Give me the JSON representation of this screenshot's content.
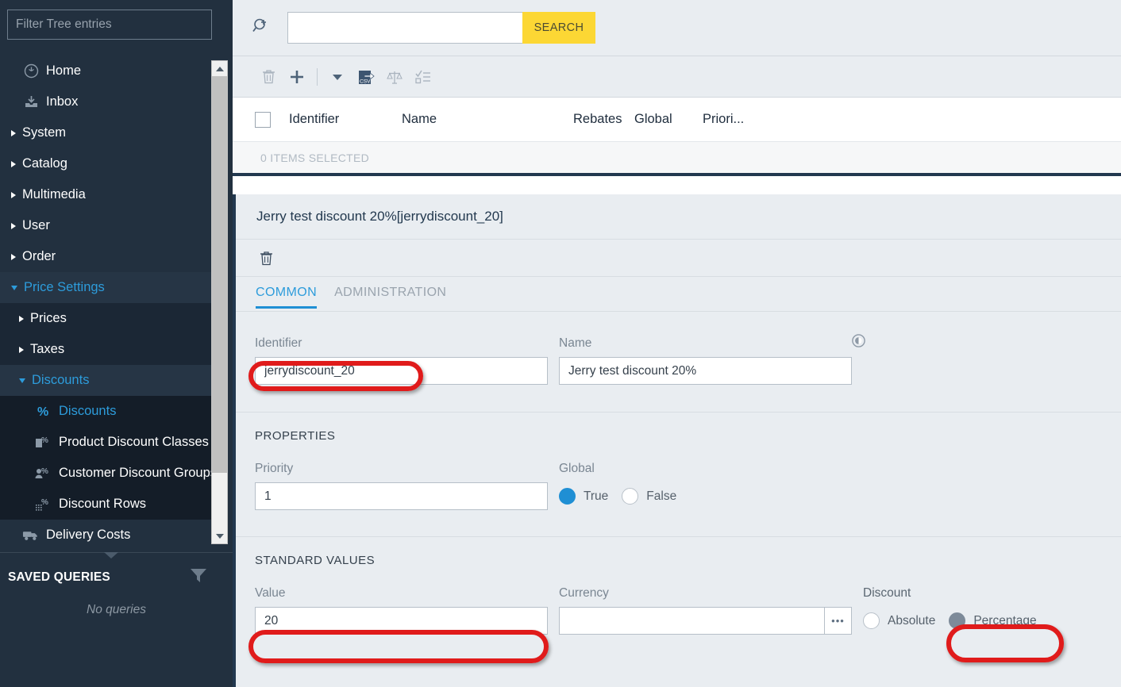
{
  "sidebar": {
    "filter_placeholder": "Filter Tree entries",
    "filter_value": "",
    "tree": [
      {
        "label": "Home",
        "level": 0,
        "caret": "none",
        "icon": "compass-icon",
        "selected": false
      },
      {
        "label": "Inbox",
        "level": 0,
        "caret": "none",
        "icon": "inbox-icon",
        "selected": false
      },
      {
        "label": "System",
        "level": 0,
        "caret": "closed",
        "icon": "none",
        "selected": false
      },
      {
        "label": "Catalog",
        "level": 0,
        "caret": "closed",
        "icon": "none",
        "selected": false
      },
      {
        "label": "Multimedia",
        "level": 0,
        "caret": "closed",
        "icon": "none",
        "selected": false
      },
      {
        "label": "User",
        "level": 0,
        "caret": "closed",
        "icon": "none",
        "selected": false
      },
      {
        "label": "Order",
        "level": 0,
        "caret": "closed",
        "icon": "none",
        "selected": false
      },
      {
        "label": "Price Settings",
        "level": 0,
        "caret": "open",
        "icon": "none",
        "selected": true
      },
      {
        "label": "Prices",
        "level": 1,
        "caret": "closed",
        "icon": "none",
        "selected": false
      },
      {
        "label": "Taxes",
        "level": 1,
        "caret": "closed",
        "icon": "none",
        "selected": false
      },
      {
        "label": "Discounts",
        "level": 1,
        "caret": "open",
        "icon": "none",
        "selected": true
      },
      {
        "label": "Discounts",
        "level": 2,
        "caret": "none",
        "icon": "percent-icon",
        "selected": true
      },
      {
        "label": "Product Discount Classes",
        "level": 2,
        "caret": "none",
        "icon": "product-percent-icon",
        "selected": false
      },
      {
        "label": "Customer Discount Groups",
        "level": 2,
        "caret": "none",
        "icon": "customer-percent-icon",
        "selected": false
      },
      {
        "label": "Discount Rows",
        "level": 2,
        "caret": "none",
        "icon": "rows-percent-icon",
        "selected": false
      },
      {
        "label": "Delivery Costs",
        "level": 0,
        "caret": "none",
        "icon": "truck-icon",
        "selected": false
      }
    ],
    "saved_queries": {
      "title": "SAVED QUERIES",
      "empty_text": "No queries",
      "filter_icon": "funnel-icon"
    }
  },
  "search": {
    "advanced_icon": "search-plus-icon",
    "input_value": "",
    "input_placeholder": "",
    "button_label": "SEARCH"
  },
  "toolbar": {
    "buttons": [
      {
        "name": "delete-button",
        "icon": "trash-icon",
        "enabled": false
      },
      {
        "name": "add-button",
        "icon": "plus-icon",
        "enabled": true
      },
      {
        "name": "add-dropdown-button",
        "icon": "caret-down-icon",
        "enabled": true
      },
      {
        "name": "export-csv-button",
        "icon": "csv-export-icon",
        "enabled": true
      },
      {
        "name": "compare-button",
        "icon": "scales-icon",
        "enabled": false
      },
      {
        "name": "checklist-button",
        "icon": "checklist-icon",
        "enabled": false
      }
    ]
  },
  "grid": {
    "columns": [
      "Identifier",
      "Name",
      "Rebates",
      "Global",
      "Priori..."
    ],
    "selection_text": "0 ITEMS SELECTED",
    "header_checkbox_checked": false
  },
  "detail": {
    "title": "Jerry test discount 20%[jerrydiscount_20]",
    "delete_icon": "trash-icon",
    "tabs": [
      {
        "label": "COMMON",
        "active": true
      },
      {
        "label": "ADMINISTRATION",
        "active": false
      }
    ],
    "common": {
      "identifier_label": "Identifier",
      "identifier_value": "jerrydiscount_20",
      "name_label": "Name",
      "name_value": "Jerry test discount 20%",
      "language_icon": "globe-icon"
    },
    "properties": {
      "section_title": "PROPERTIES",
      "priority_label": "Priority",
      "priority_value": "1",
      "global_label": "Global",
      "global_options": [
        {
          "label": "True",
          "selected": true,
          "style": "blue"
        },
        {
          "label": "False",
          "selected": false,
          "style": "blue"
        }
      ]
    },
    "standard_values": {
      "section_title": "STANDARD VALUES",
      "value_label": "Value",
      "value_value": "20",
      "currency_label": "Currency",
      "currency_value": "",
      "currency_picker_label": "•••",
      "discount_label": "Discount",
      "discount_options": [
        {
          "label": "Absolute",
          "selected": false,
          "style": "gray"
        },
        {
          "label": "Percentage",
          "selected": true,
          "style": "gray"
        }
      ]
    }
  },
  "annotations": {
    "accent_color": "#e01b1b",
    "highlights": [
      "identifier-field",
      "value-field",
      "percentage-radio"
    ]
  }
}
